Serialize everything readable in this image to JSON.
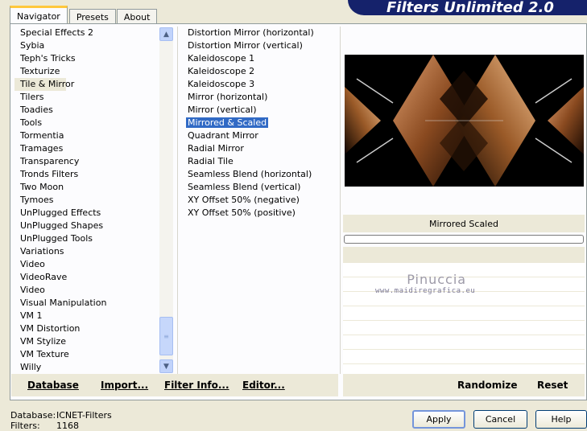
{
  "tabs": [
    "Navigator",
    "Presets",
    "About"
  ],
  "banner_title": "Filters Unlimited 2.0",
  "categories": [
    "Special Effects 2",
    "Sybia",
    "Teph's Tricks",
    "Texturize",
    "Tile & Mirror",
    "Tilers",
    "Toadies",
    "Tools",
    "Tormentia",
    "Tramages",
    "Transparency",
    "Tronds Filters",
    "Two Moon",
    "Tymoes",
    "UnPlugged Effects",
    "UnPlugged Shapes",
    "UnPlugged Tools",
    "Variations",
    "Video",
    "VideoRave",
    "Video",
    "Visual Manipulation",
    "VM 1",
    "VM Distortion",
    "VM Stylize",
    "VM Texture",
    "Willy"
  ],
  "selected_category": "Tile & Mirror",
  "filters": [
    "Distortion Mirror (horizontal)",
    "Distortion Mirror (vertical)",
    "Kaleidoscope 1",
    "Kaleidoscope 2",
    "Kaleidoscope 3",
    "Mirror (horizontal)",
    "Mirror (vertical)",
    "Mirrored & Scaled",
    "Quadrant Mirror",
    "Radial Mirror",
    "Radial Tile",
    "Seamless Blend (horizontal)",
    "Seamless Blend (vertical)",
    "XY Offset 50% (negative)",
    "XY Offset 50% (positive)"
  ],
  "selected_filter": "Mirrored & Scaled",
  "param_title": "Mirrored  Scaled",
  "watermark": {
    "line1": "Pinuccia",
    "line2": "www.maidiregrafica.eu"
  },
  "bottom_left": {
    "database": "Database",
    "import": "Import...",
    "filter_info": "Filter Info...",
    "editor": "Editor..."
  },
  "bottom_right": {
    "randomize": "Randomize",
    "reset": "Reset"
  },
  "status": {
    "db_label": "Database:",
    "db_value": "ICNET-Filters",
    "filters_label": "Filters:",
    "filters_value": "1168"
  },
  "buttons": {
    "apply": "Apply",
    "cancel": "Cancel",
    "help": "Help"
  }
}
